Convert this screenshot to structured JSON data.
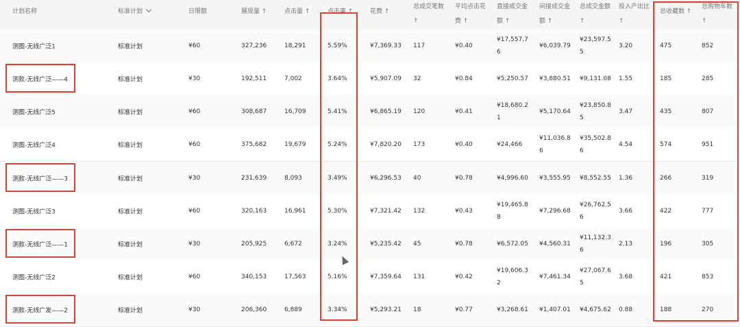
{
  "header": {
    "c1": "计划名称",
    "c2": "标准计划",
    "c3": "日限额",
    "c4": "展现量 ↑",
    "c5": "点击量 ↑",
    "c6": "点击率 ↑",
    "c7": "花费 ↑",
    "c8a": "总成交笔数",
    "c8b": "↑",
    "c9a": "平均点击花",
    "c9b": "费 ↑",
    "c10a": "直接成交金",
    "c10b": "额 ↑",
    "c11a": "间接成交金",
    "c11b": "额 ↑",
    "c12a": "总成交金额",
    "c12b": "↑",
    "c13a": "投入产出比",
    "c13b": "↑",
    "c14a": "总收藏数 ↑",
    "c15a": "总购物车数",
    "c15b": "↑"
  },
  "rows": [
    {
      "name": "测图-无线广泛1",
      "plan": "标准计划",
      "limit": "¥60",
      "impr": "327,236",
      "clicks": "18,291",
      "ctr": "5.59%",
      "cost": "¥7,369.33",
      "orders": "117",
      "cpc": "¥0.40",
      "direct_a": "¥17,557.7",
      "direct_b": "6",
      "indirect_a": "¥6,039.79",
      "indirect_b": "",
      "total_a": "¥23,597.5",
      "total_b": "5",
      "roi": "3.20",
      "fav": "475",
      "cart": "852"
    },
    {
      "name": "测款-无线广泛——4",
      "plan": "标准计划",
      "limit": "¥30",
      "impr": "192,511",
      "clicks": "7,002",
      "ctr": "3.64%",
      "cost": "¥5,907.09",
      "orders": "32",
      "cpc": "¥0.84",
      "direct_a": "¥5,250.57",
      "direct_b": "",
      "indirect_a": "¥3,880.51",
      "indirect_b": "",
      "total_a": "¥9,131.08",
      "total_b": "",
      "roi": "1.55",
      "fav": "185",
      "cart": "285"
    },
    {
      "name": "测图-无线广泛5",
      "plan": "标准计划",
      "limit": "¥60",
      "impr": "308,687",
      "clicks": "16,709",
      "ctr": "5.41%",
      "cost": "¥6,865.19",
      "orders": "120",
      "cpc": "¥0.41",
      "direct_a": "¥18,680.2",
      "direct_b": "1",
      "indirect_a": "¥5,170.64",
      "indirect_b": "",
      "total_a": "¥23,850.8",
      "total_b": "5",
      "roi": "3.47",
      "fav": "435",
      "cart": "807"
    },
    {
      "name": "测图-无线广泛4",
      "plan": "标准计划",
      "limit": "¥60",
      "impr": "375,682",
      "clicks": "19,679",
      "ctr": "5.24%",
      "cost": "¥7,820.20",
      "orders": "173",
      "cpc": "¥0.40",
      "direct_a": "¥24,466",
      "direct_b": "",
      "indirect_a": "¥11,036.8",
      "indirect_b": "6",
      "total_a": "¥35,502.8",
      "total_b": "6",
      "roi": "4.54",
      "fav": "574",
      "cart": "951"
    },
    {
      "name": "测款-无线广泛——3",
      "plan": "标准计划",
      "limit": "¥30",
      "impr": "231,639",
      "clicks": "8,093",
      "ctr": "3.49%",
      "cost": "¥6,296.53",
      "orders": "40",
      "cpc": "¥0.78",
      "direct_a": "¥4,996.60",
      "direct_b": "",
      "indirect_a": "¥3,555.95",
      "indirect_b": "",
      "total_a": "¥8,552.55",
      "total_b": "",
      "roi": "1.36",
      "fav": "266",
      "cart": "319"
    },
    {
      "name": "测图-无线广泛3",
      "plan": "标准计划",
      "limit": "¥60",
      "impr": "320,163",
      "clicks": "16,961",
      "ctr": "5.30%",
      "cost": "¥7,321.42",
      "orders": "132",
      "cpc": "¥0.43",
      "direct_a": "¥19,465.8",
      "direct_b": "8",
      "indirect_a": "¥7,296.68",
      "indirect_b": "",
      "total_a": "¥26,762.5",
      "total_b": "6",
      "roi": "3.66",
      "fav": "422",
      "cart": "777"
    },
    {
      "name": "测款-无线广泛——1",
      "plan": "标准计划",
      "limit": "¥30",
      "impr": "205,925",
      "clicks": "6,672",
      "ctr": "3.24%",
      "cost": "¥5,235.42",
      "orders": "45",
      "cpc": "¥0.78",
      "direct_a": "¥6,572.05",
      "direct_b": "",
      "indirect_a": "¥4,560.31",
      "indirect_b": "",
      "total_a": "¥11,132.3",
      "total_b": "6",
      "roi": "2.13",
      "fav": "196",
      "cart": "305"
    },
    {
      "name": "测图-无线广泛2",
      "plan": "标准计划",
      "limit": "¥60",
      "impr": "340,153",
      "clicks": "17,563",
      "ctr": "5.16%",
      "cost": "¥7,359.64",
      "orders": "131",
      "cpc": "¥0.42",
      "direct_a": "¥19,606.3",
      "direct_b": "2",
      "indirect_a": "¥7,461.34",
      "indirect_b": "",
      "total_a": "¥27,067.6",
      "total_b": "5",
      "roi": "3.68",
      "fav": "421",
      "cart": "853"
    },
    {
      "name": "测款-无线广发——2",
      "plan": "标准计划",
      "limit": "¥30",
      "impr": "206,360",
      "clicks": "6,889",
      "ctr": "3.34%",
      "cost": "¥5,293.21",
      "orders": "18",
      "cpc": "¥0.77",
      "direct_a": "¥3,268.61",
      "direct_b": "",
      "indirect_a": "¥1,407.01",
      "indirect_b": "",
      "total_a": "¥4,675.62",
      "total_b": "",
      "roi": "0.88",
      "fav": "188",
      "cart": "270"
    }
  ],
  "highlight_color": "#e0412f"
}
